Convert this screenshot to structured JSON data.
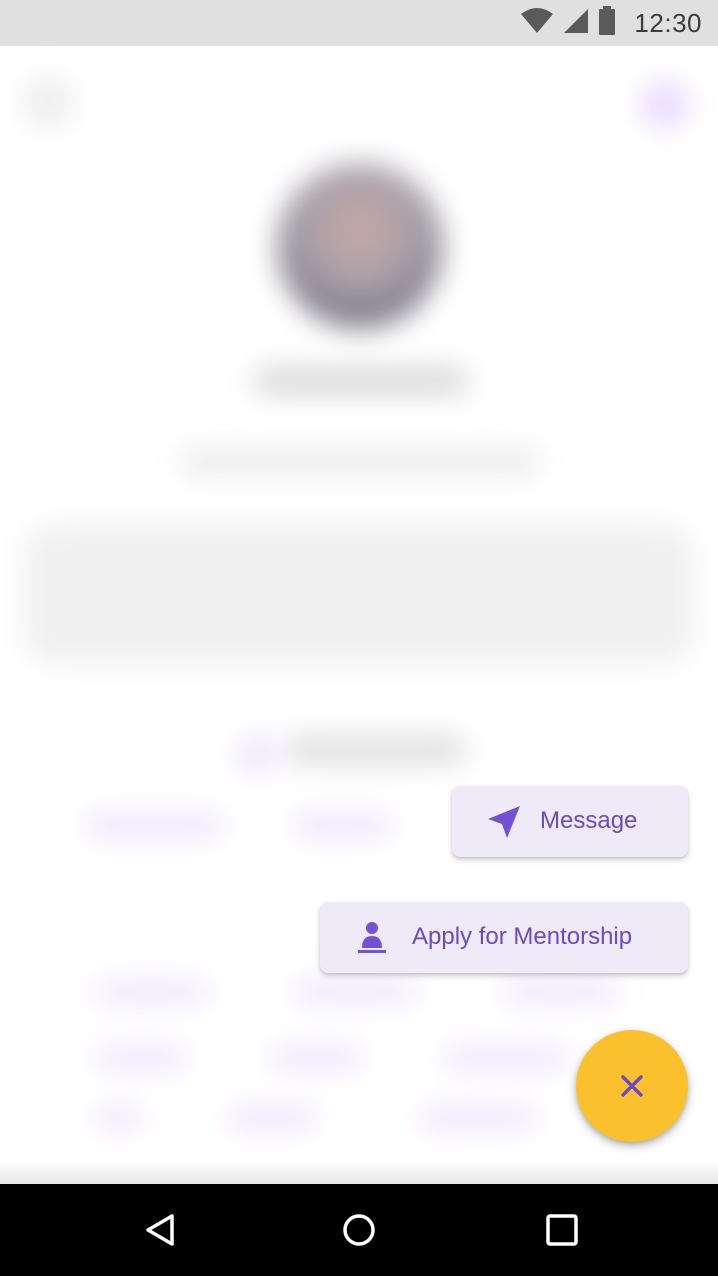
{
  "status_bar": {
    "time": "12:30",
    "icons": [
      "wifi-icon",
      "signal-icon",
      "battery-icon"
    ]
  },
  "actions": {
    "message_label": "Message",
    "message_icon": "send-icon",
    "mentorship_label": "Apply for Mentorship",
    "mentorship_icon": "person-icon",
    "fab_icon": "close-icon"
  },
  "nav_bar": {
    "icons": [
      "back-icon",
      "home-icon",
      "recents-icon"
    ]
  },
  "colors": {
    "accent": "#6a4bc4",
    "chip_background": "#efeaf7",
    "fab_background": "#fbc02d",
    "status_bar": "#e0e0e0",
    "nav_bar": "#000000"
  }
}
